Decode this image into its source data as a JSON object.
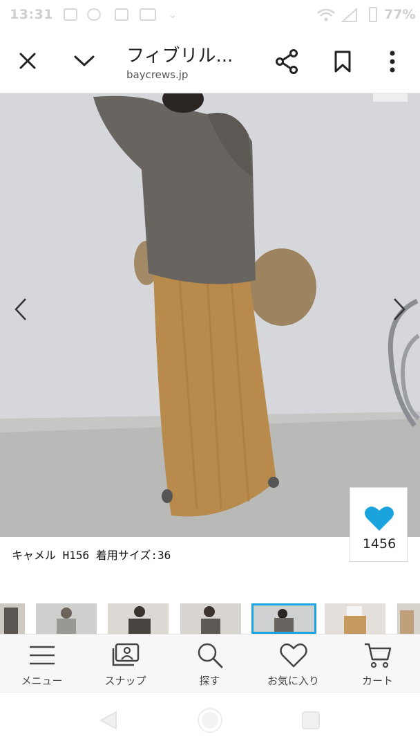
{
  "status_bar": {
    "time": "13:31",
    "battery": "77%"
  },
  "header": {
    "title": "フィブリル...",
    "url": "baycrews.jp"
  },
  "product": {
    "caption": "キャメル H156 着用サイズ:36",
    "favorite_count": "1456"
  },
  "icons": {
    "close": "close-icon",
    "collapse": "chevron-down-icon",
    "share": "share-icon",
    "bookmark": "bookmark-icon",
    "more": "more-vert-icon",
    "prev": "chevron-left-icon",
    "next": "chevron-right-icon",
    "favorite": "heart-icon"
  },
  "colors": {
    "accent": "#1aa3dd",
    "heart": "#1aa3dd"
  },
  "bottom_nav": {
    "items": [
      {
        "label": "メニュー",
        "icon": "menu-icon"
      },
      {
        "label": "スナップ",
        "icon": "snap-icon"
      },
      {
        "label": "探す",
        "icon": "search-icon"
      },
      {
        "label": "お気に入り",
        "icon": "heart-outline-icon"
      },
      {
        "label": "カート",
        "icon": "cart-icon"
      }
    ]
  }
}
